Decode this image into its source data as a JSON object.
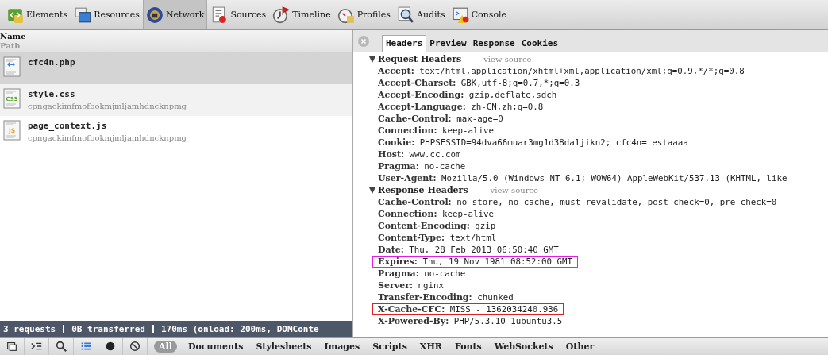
{
  "toolbar": {
    "tabs": [
      {
        "label": "Elements",
        "kind": "elements",
        "selected": false
      },
      {
        "label": "Resources",
        "kind": "resources",
        "selected": false
      },
      {
        "label": "Network",
        "kind": "network",
        "selected": true
      },
      {
        "label": "Sources",
        "kind": "sources",
        "selected": false
      },
      {
        "label": "Timeline",
        "kind": "timeline",
        "selected": false
      },
      {
        "label": "Profiles",
        "kind": "profiles",
        "selected": false
      },
      {
        "label": "Audits",
        "kind": "audits",
        "selected": false
      },
      {
        "label": "Console",
        "kind": "console",
        "selected": false
      }
    ]
  },
  "request_list": {
    "column_header": {
      "name": "Name",
      "path": "Path"
    },
    "requests": [
      {
        "name": "cfc4n.php",
        "kind": "php",
        "selected": true
      },
      {
        "name": "style.css",
        "path": "cpngackimfmofbokmjmljamhdncknpmg",
        "kind": "css",
        "icon_text": "CSS",
        "selected": false
      },
      {
        "name": "page_context.js",
        "path": "cpngackimfmofbokmjmljamhdncknpmg",
        "kind": "js",
        "icon_text": "JS",
        "selected": false
      }
    ]
  },
  "status_bar": [
    "3 requests",
    "0B transferred",
    "170ms (onload: 200ms, DOMConte"
  ],
  "details": {
    "tabs": [
      {
        "label": "Headers",
        "selected": true
      },
      {
        "label": "Preview",
        "selected": false
      },
      {
        "label": "Response",
        "selected": false
      },
      {
        "label": "Cookies",
        "selected": false
      }
    ],
    "sections": [
      {
        "title": "Request Headers",
        "link": "view source",
        "expanded": true,
        "headers": [
          {
            "name": "Accept:",
            "value": "text/html,application/xhtml+xml,application/xml;q=0.9,*/*;q=0.8"
          },
          {
            "name": "Accept-Charset:",
            "value": "GBK,utf-8;q=0.7,*;q=0.3"
          },
          {
            "name": "Accept-Encoding:",
            "value": "gzip,deflate,sdch"
          },
          {
            "name": "Accept-Language:",
            "value": "zh-CN,zh;q=0.8"
          },
          {
            "name": "Cache-Control:",
            "value": "max-age=0"
          },
          {
            "name": "Connection:",
            "value": "keep-alive"
          },
          {
            "name": "Cookie:",
            "value": "PHPSESSID=94dva66muar3mg1d38da1jikn2; cfc4n=testaaaa"
          },
          {
            "name": "Host:",
            "value": "www.cc.com"
          },
          {
            "name": "Pragma:",
            "value": "no-cache"
          },
          {
            "name": "User-Agent:",
            "value": "Mozilla/5.0 (Windows NT 6.1; WOW64) AppleWebKit/537.13 (KHTML, like"
          }
        ]
      },
      {
        "title": "Response Headers",
        "link": "view source",
        "expanded": true,
        "headers": [
          {
            "name": "Cache-Control:",
            "value": "no-store, no-cache, must-revalidate, post-check=0, pre-check=0"
          },
          {
            "name": "Connection:",
            "value": "keep-alive"
          },
          {
            "name": "Content-Encoding:",
            "value": "gzip"
          },
          {
            "name": "Content-Type:",
            "value": "text/html"
          },
          {
            "name": "Date:",
            "value": "Thu, 28 Feb 2013 06:50:40 GMT"
          },
          {
            "name": "Expires:",
            "value": "Thu, 19 Nov 1981 08:52:00 GMT",
            "color": "#e020e0"
          },
          {
            "name": "Pragma:",
            "value": "no-cache"
          },
          {
            "name": "Server:",
            "value": "nginx"
          },
          {
            "name": "Transfer-Encoding:",
            "value": "chunked"
          },
          {
            "name": "X-Cache-CFC:",
            "value": "MISS - 1362034240.936",
            "color": "#e02020"
          },
          {
            "name": "X-Powered-By:",
            "value": "PHP/5.3.10-1ubuntu3.5"
          }
        ]
      }
    ]
  },
  "filter_bar": {
    "filters": [
      {
        "label": "All",
        "selected": true
      },
      {
        "label": "Documents",
        "selected": false
      },
      {
        "label": "Stylesheets",
        "selected": false
      },
      {
        "label": "Images",
        "selected": false
      },
      {
        "label": "Scripts",
        "selected": false
      },
      {
        "label": "XHR",
        "selected": false
      },
      {
        "label": "Fonts",
        "selected": false
      },
      {
        "label": "WebSockets",
        "selected": false
      },
      {
        "label": "Other",
        "selected": false
      }
    ]
  }
}
